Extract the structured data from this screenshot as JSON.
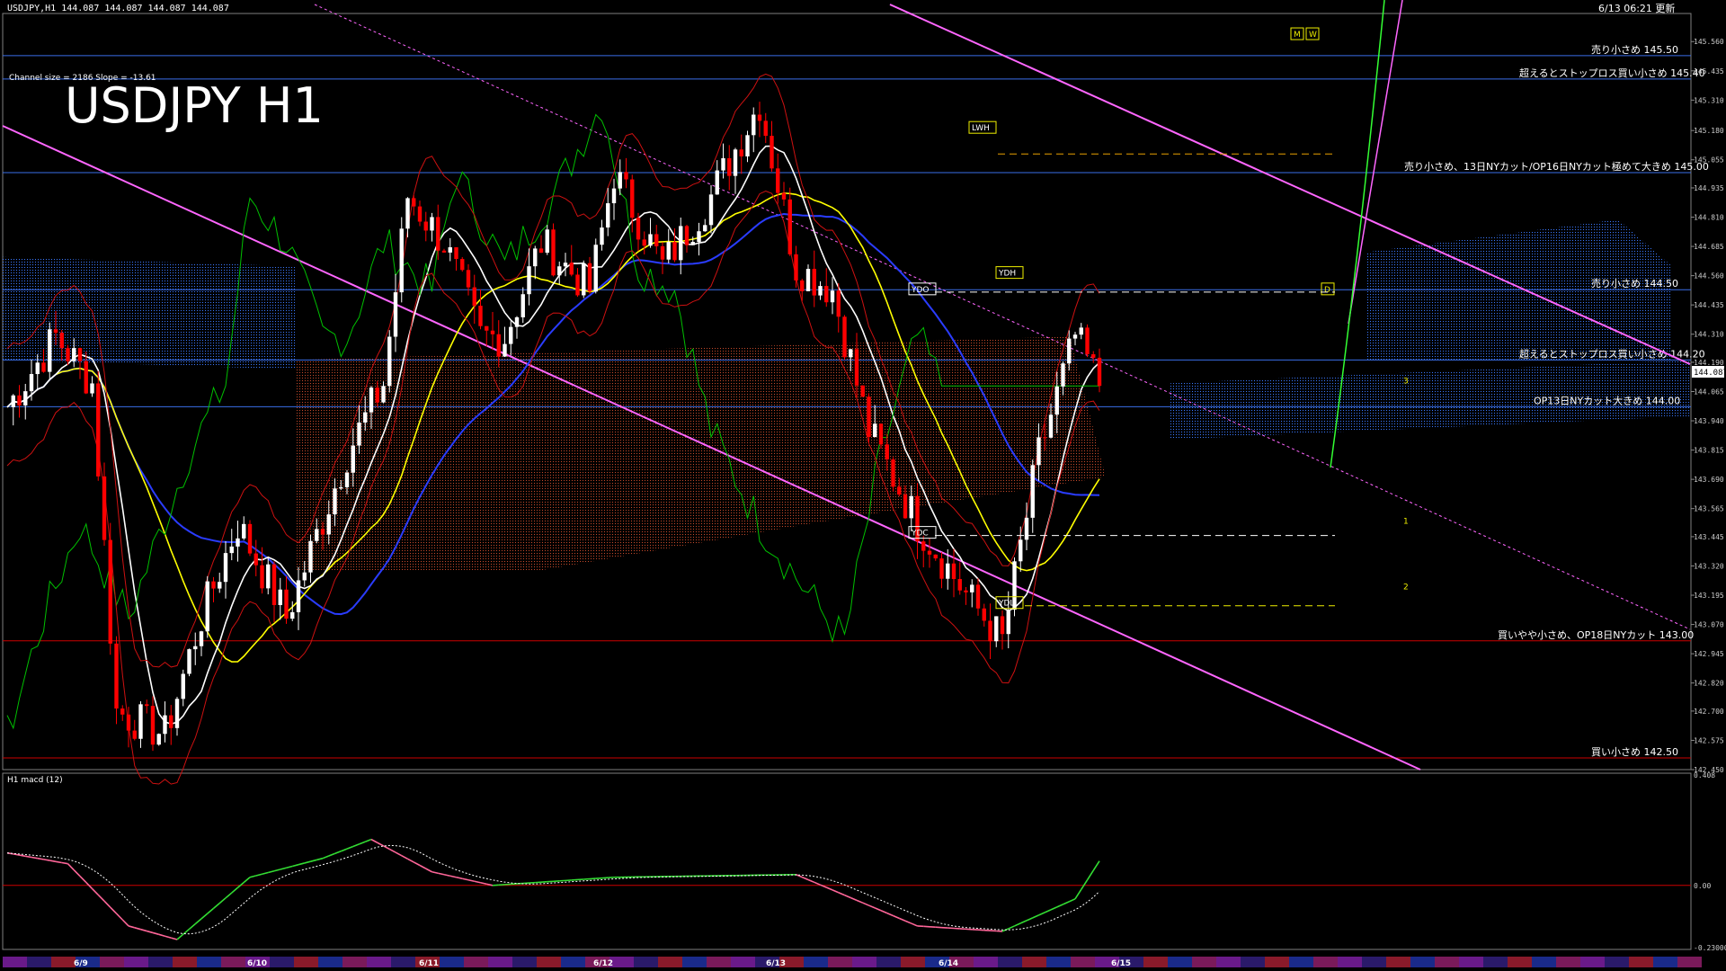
{
  "header": {
    "symbol_info": "USDJPY,H1  144.087 144.087 144.087 144.087",
    "timestamp": "6/13 06:21 更新"
  },
  "chart_title": "USDJPY H1",
  "channel_info": "Channel size = 2186 Slope = -13.61",
  "subwindow_label": "H1  macd (12)",
  "current_price_label": "144.087",
  "colors": {
    "background": "#000000",
    "bull_candle": "#ffffff",
    "bear_candle": "#ff0000",
    "ichimoku_cloud_bull": "#3a78ff",
    "ichimoku_cloud_bear": "#c84a2a",
    "channel": "#ff66ff",
    "level_line_blue": "#3a6ee8",
    "level_line_red": "#cc0000",
    "sma_white": "#ffffff",
    "sma_yellow": "#ffff00",
    "sma_blue": "#2a3cff",
    "chikou_green": "#00c000",
    "macd_green": "#33dd33",
    "macd_pink": "#ff6699"
  },
  "chart_data": {
    "type": "candlestick",
    "y_range": [
      142.45,
      145.68
    ],
    "y_ticks": [
      "145.560",
      "145.435",
      "145.310",
      "145.180",
      "145.055",
      "144.935",
      "144.810",
      "144.685",
      "144.560",
      "144.435",
      "144.310",
      "144.190",
      "144.065",
      "143.940",
      "143.815",
      "143.690",
      "143.565",
      "143.445",
      "143.320",
      "143.195",
      "143.070",
      "142.945",
      "142.820",
      "142.700",
      "142.575",
      "142.450"
    ],
    "x_labels": [
      "6/9",
      "6/10",
      "6/11",
      "6/12",
      "6/13",
      "6/14",
      "6/15"
    ],
    "levels": [
      {
        "price": 145.5,
        "label": "売り小さめ 145.50",
        "color": "blue"
      },
      {
        "price": 145.4,
        "label": "超えるとストップロス買い小さめ 145.40",
        "color": "blue"
      },
      {
        "price": 145.0,
        "label": "売り小さめ、13日NYカット/OP16日NYカット極めて大きめ 145.00",
        "color": "blue"
      },
      {
        "price": 144.5,
        "label": "売り小さめ 144.50",
        "color": "blue"
      },
      {
        "price": 144.2,
        "label": "超えるとストップロス買い小さめ 144.20",
        "color": "blue"
      },
      {
        "price": 144.0,
        "label": "OP13日NYカット大きめ 144.00",
        "color": "blue"
      },
      {
        "price": 143.0,
        "label": "買いやや小さめ、OP18日NYカット 143.00",
        "color": "red"
      },
      {
        "price": 142.5,
        "label": "買い小さめ 142.50",
        "color": "red"
      }
    ],
    "markers": [
      "YDO",
      "YDH",
      "YDC",
      "YDL",
      "LWH",
      "D",
      "M",
      "W",
      "1",
      "2",
      "3"
    ],
    "macd": {
      "y_range": [
        -0.23,
        0.408
      ],
      "y_ticks": [
        "0.408",
        "0.00",
        "-0.230000"
      ],
      "zero_label": "0.00"
    }
  }
}
